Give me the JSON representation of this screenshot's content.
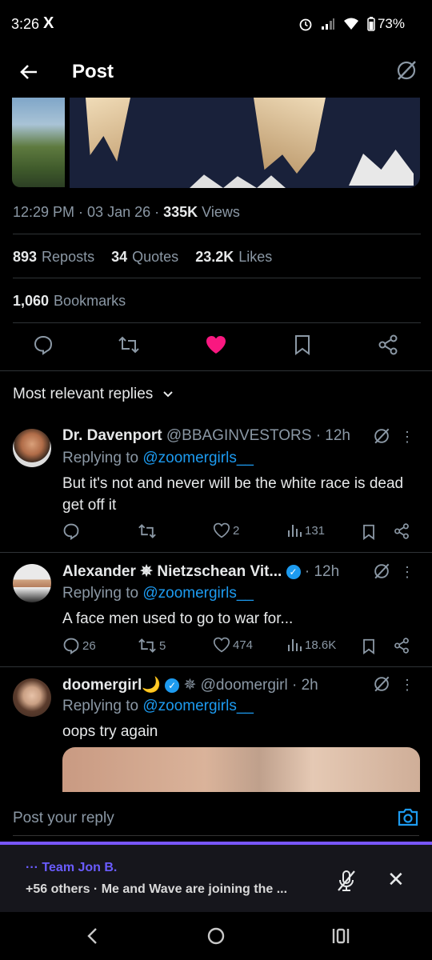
{
  "status_bar": {
    "time": "3:26",
    "app_logo": "X",
    "battery": "73%",
    "icons": [
      "alarm-icon",
      "signal-icon",
      "wifi-icon",
      "battery-icon"
    ]
  },
  "header": {
    "title": "Post",
    "back_icon": "arrow-left-icon",
    "grok_icon": "grok-icon"
  },
  "post_meta": {
    "time": "12:29 PM · 03 Jan 26 · ",
    "views_count": "335K",
    "views_label": " Views"
  },
  "stats": {
    "reposts_count": "893",
    "reposts_label": "Reposts",
    "quotes_count": "34",
    "quotes_label": "Quotes",
    "likes_count": "23.2K",
    "likes_label": "Likes",
    "bookmarks_count": "1,060",
    "bookmarks_label": "Bookmarks"
  },
  "colors": {
    "like": "#f91880",
    "link": "#1d9bf0",
    "verified": "#1d9bf0",
    "space_accent": "#7856ff"
  },
  "sort": {
    "label": "Most relevant replies"
  },
  "replies": [
    {
      "name": "Dr. Davenport",
      "handle": "@BBAGINVESTORS · 12h",
      "replying_prefix": "Replying to ",
      "replying_to": "@zoomergirls__",
      "text": "But it's not and never will be the white race is dead get off it",
      "replies": "",
      "reposts": "",
      "likes": "2",
      "views": "131"
    },
    {
      "name": "Alexander ✵ Nietzschean Vit...",
      "handle": " · 12h",
      "replying_prefix": "Replying to ",
      "replying_to": "@zoomergirls__",
      "text": "A face men used to go to war for...",
      "replies": "26",
      "reposts": "5",
      "likes": "474",
      "views": "18.6K"
    },
    {
      "name": "doomergirl🌙",
      "handle": " ✵ @doomergirl · 2h",
      "replying_prefix": "Replying to ",
      "replying_to": "@zoomergirls__",
      "text": "oops try again"
    }
  ],
  "composer": {
    "placeholder": "Post your reply"
  },
  "space": {
    "team": "··· Team Jon B.",
    "subtitle": "+56 others · Me and Wave are joining the ..."
  },
  "nav": {
    "back": "<",
    "home": "○",
    "recents": "|||"
  }
}
